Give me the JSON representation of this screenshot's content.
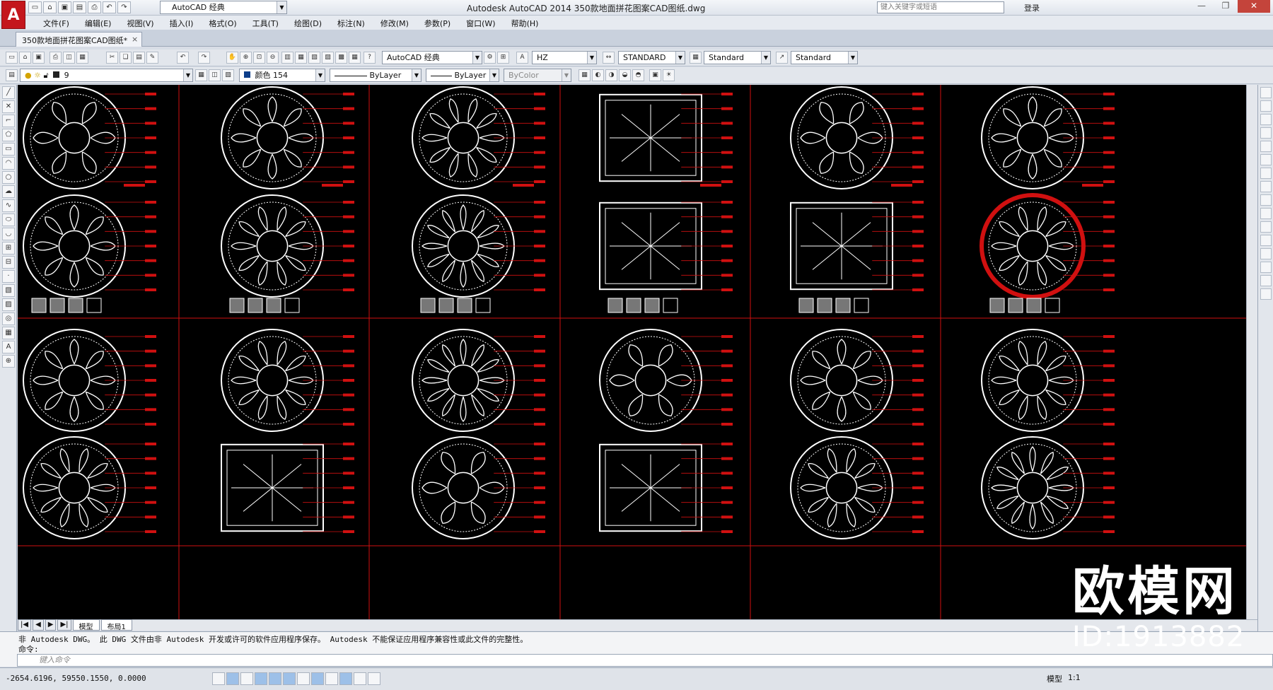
{
  "app": {
    "title": "Autodesk AutoCAD 2014     350款地面拼花图案CAD图纸.dwg",
    "logo": "A",
    "workspace": "AutoCAD 经典",
    "search_placeholder": "键入关键字或短语",
    "login": "登录",
    "win_min": "—",
    "win_max": "❐",
    "win_close": "✕"
  },
  "menus": [
    "文件(F)",
    "编辑(E)",
    "视图(V)",
    "插入(I)",
    "格式(O)",
    "工具(T)",
    "绘图(D)",
    "标注(N)",
    "修改(M)",
    "参数(P)",
    "窗口(W)",
    "帮助(H)"
  ],
  "document_tab": {
    "label": "350款地面拼花图案CAD图纸*",
    "close": "×"
  },
  "toolbar1": {
    "workspace": "AutoCAD 经典",
    "text_style": "HZ",
    "dim_style": "STANDARD",
    "table_style": "Standard",
    "mleader_style": "Standard"
  },
  "toolbar2": {
    "layer": "9",
    "color": "颜色 154",
    "linetype": "ByLayer",
    "lineweight": "ByLayer",
    "plotstyle": "ByColor"
  },
  "layout_tabs": [
    "模型",
    "布局1"
  ],
  "command": {
    "message": "非 Autodesk DWG。 此 DWG 文件由非 Autodesk 开发或许可的软件应用程序保存。 Autodesk 不能保证应用程序兼容性或此文件的完整性。",
    "prompt": "命令:",
    "input_placeholder": "键入命令"
  },
  "status": {
    "coords": "-2654.6196, 59550.1550, 0.0000",
    "model": "模型",
    "scale": "1:1"
  },
  "watermark": {
    "brand": "欧模网",
    "id": "ID:1913882"
  },
  "colors": {
    "background": "#000000",
    "frame": "#d01010",
    "drawing": "#ffffff",
    "accent": "#c4161c"
  }
}
